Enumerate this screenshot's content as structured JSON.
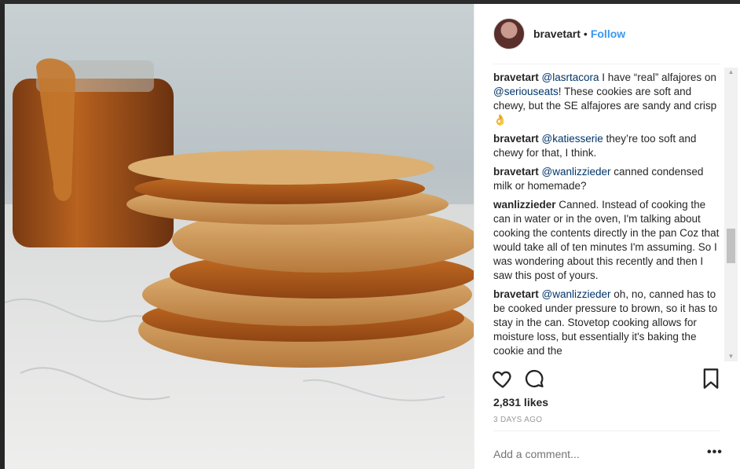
{
  "post": {
    "username": "bravetart",
    "separator": "•",
    "follow_label": "Follow",
    "likes": "2,831 likes",
    "time_ago": "3 DAYS AGO",
    "add_comment_placeholder": "Add a comment...",
    "more_icon": "more-options-icon",
    "comments": [
      {
        "user": "bravetart",
        "mention": "@lasrtacora",
        "text1": " I have “real” alfajores on ",
        "mention2": "@seriouseats",
        "text2": "! These cookies are soft and chewy, but the SE alfajores are sandy and crisp 👌"
      },
      {
        "user": "bravetart",
        "mention": "@katiesserie",
        "text1": " they’re too soft and chewy for that, I think."
      },
      {
        "user": "bravetart",
        "mention": "@wanlizzieder",
        "text1": " canned condensed milk or homemade?"
      },
      {
        "user": "wanlizzieder",
        "text1": " Canned. Instead of cooking the can in water or in the oven, I'm talking about cooking the contents directly in the pan Coz that would take all of ten minutes I'm assuming. So I was wondering about this recently and then I saw this post of yours."
      },
      {
        "user": "bravetart",
        "mention": "@wanlizzieder",
        "text1": " oh, no, canned has to be cooked under pressure to brown, so it has to stay in the can. Stovetop cooking allows for moisture loss, but essentially it's baking the cookie and the"
      }
    ]
  },
  "colors": {
    "link": "#3897f0",
    "mention": "#003569",
    "muted": "#999999"
  }
}
